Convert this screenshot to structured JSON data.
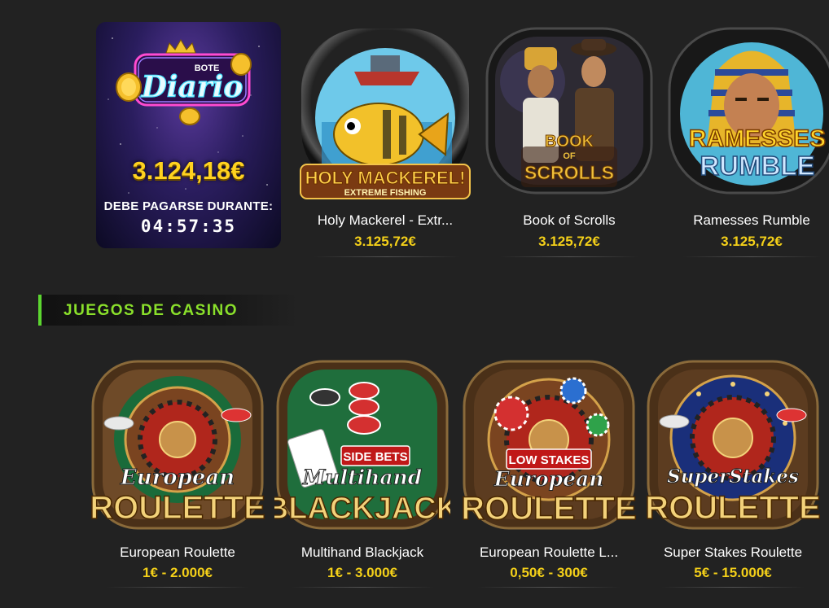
{
  "jackpot": {
    "logo_small": "BOTE",
    "logo_main": "Diario",
    "amount": "3.124,18€",
    "label": "DEBE PAGARSE DURANTE:",
    "timer": "04:57:35"
  },
  "top_games": [
    {
      "name": "Holy Mackerel - Extr...",
      "value": "3.125,72€",
      "art_line1": "HOLY MACKEREL!",
      "art_line2": "EXTREME FISHING"
    },
    {
      "name": "Book of Scrolls",
      "value": "3.125,72€",
      "art_line1": "BOOK",
      "art_line2": "OF",
      "art_line3": "SCROLLS"
    },
    {
      "name": "Ramesses Rumble",
      "value": "3.125,72€",
      "art_line1": "RAMESSES",
      "art_line2": "RUMBLE"
    }
  ],
  "casino_section": {
    "title": "JUEGOS DE CASINO",
    "accent": "#5cd630"
  },
  "casino_games": [
    {
      "name": "European Roulette",
      "range": "1€ - 2.000€",
      "art_top": "European",
      "art_main": "ROULETTE"
    },
    {
      "name": "Multihand Blackjack",
      "range": "1€ - 3.000€",
      "art_badge": "SIDE BETS",
      "art_top": "Multihand",
      "art_main": "BLACKJACK"
    },
    {
      "name": "European Roulette L...",
      "range": "0,50€ - 300€",
      "art_badge": "LOW STAKES",
      "art_top": "European",
      "art_main": "ROULETTE"
    },
    {
      "name": "Super Stakes Roulette",
      "range": "5€ - 15.000€",
      "art_top": "SuperStakes",
      "art_main": "ROULETTE"
    }
  ],
  "colors": {
    "background": "#222222",
    "gold": "#f4d019",
    "accent_green": "#5cd630"
  }
}
